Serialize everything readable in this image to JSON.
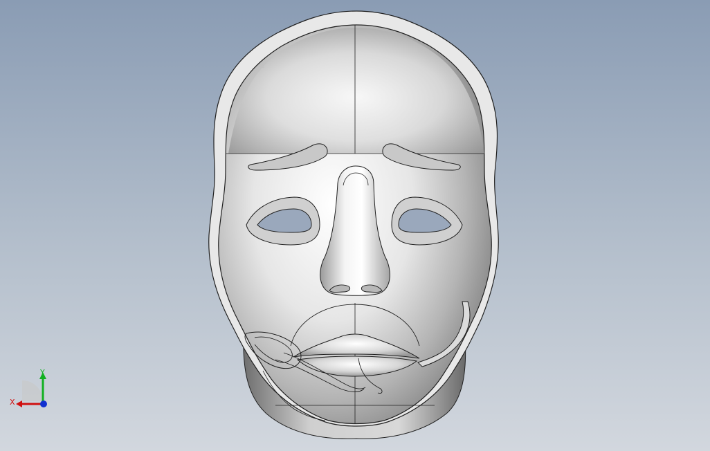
{
  "viewport": {
    "gradient_top": "#8a9cb4",
    "gradient_bottom": "#d2d7de"
  },
  "model": {
    "name": "face-mask",
    "shell_color": "#e4e4e4",
    "edge_color": "#202020",
    "highlight_color": "#ffffff",
    "shadow_color": "#7a7a7a"
  },
  "triad": {
    "x_label": "X",
    "y_label": "Y",
    "x_color": "#d01010",
    "y_color": "#10b020",
    "z_color": "#1030d0"
  }
}
